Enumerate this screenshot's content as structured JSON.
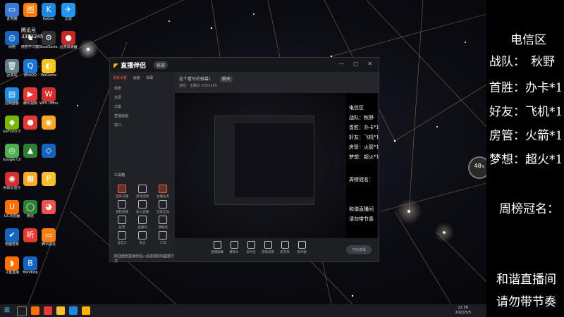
{
  "desktop": {
    "icons": [
      {
        "label": "此电脑",
        "color": "#3a7bd5",
        "glyph": "▭"
      },
      {
        "label": "",
        "color": "#ff7a00",
        "glyph": "图"
      },
      {
        "label": "KaGou",
        "color": "#1e88e5",
        "glyph": "K"
      },
      {
        "label": "迅雷",
        "color": "#2196f3",
        "glyph": "✈"
      },
      {
        "label": "网络",
        "color": "#1565c0",
        "glyph": "◎"
      },
      {
        "label": "随意学习模拟",
        "color": "#222",
        "glyph": "♞"
      },
      {
        "label": "SteelSeries",
        "color": "#333",
        "glyph": "⚙"
      },
      {
        "label": "迅游加速器",
        "color": "#c62828",
        "glyph": "●"
      },
      {
        "label": "回收站",
        "color": "#607d8b",
        "glyph": "🗑"
      },
      {
        "label": "腾讯QQ",
        "color": "#1976d2",
        "glyph": "Q"
      },
      {
        "label": "WeGame",
        "color": "#f5c518",
        "glyph": "◐"
      },
      {
        "label": "控制面板",
        "color": "#1e88e5",
        "glyph": "▤"
      },
      {
        "label": "腾讯视频",
        "color": "#e53935",
        "glyph": "▶"
      },
      {
        "label": "WPS Office",
        "color": "#d32f2f",
        "glyph": "W"
      },
      {
        "label": "GeForce Experience",
        "color": "#76b900",
        "glyph": "◆"
      },
      {
        "label": "",
        "color": "#e53935",
        "glyph": "●"
      },
      {
        "label": "",
        "color": "#f9a825",
        "glyph": "◉"
      },
      {
        "label": "Google Chrome",
        "color": "#4caf50",
        "glyph": "◎"
      },
      {
        "label": "",
        "color": "#2e7d32",
        "glyph": "▲"
      },
      {
        "label": "",
        "color": "#1565c0",
        "glyph": "◇"
      },
      {
        "label": "网易云音乐",
        "color": "#d32f2f",
        "glyph": "◉"
      },
      {
        "label": "",
        "color": "#f9a825",
        "glyph": "▦"
      },
      {
        "label": "UC浏览器",
        "color": "#ff6f00",
        "glyph": "U"
      },
      {
        "label": "微信",
        "color": "#2e7d32",
        "glyph": "◯"
      },
      {
        "label": "",
        "color": "#fbc02d",
        "glyph": "P"
      },
      {
        "label": "电脑管家",
        "color": "#1565c0",
        "glyph": "✔"
      },
      {
        "label": "",
        "color": "#e53935",
        "glyph": "听"
      },
      {
        "label": "",
        "color": "#ef5350",
        "glyph": "◕"
      },
      {
        "label": "斗鱼直播",
        "color": "#ff6f00",
        "glyph": "◗"
      },
      {
        "label": "Bandizip",
        "color": "#1565c0",
        "glyph": "B"
      },
      {
        "label": "腾讯会议",
        "color": "#f57f17",
        "glyph": "▭"
      }
    ],
    "top_text_1": "腾讯号",
    "top_text_2": "3353245"
  },
  "app": {
    "title": "直播伴侣",
    "badge": "帐密",
    "window_controls": "— ▢ ✕",
    "tabs": [
      "场景设置",
      "画面",
      "弹幕"
    ],
    "scenes": [
      "场景",
      "全屏",
      "文案",
      "直播画面",
      "窗口"
    ],
    "tools_title": "工具箱",
    "tools": [
      "连屏开播",
      "游戏宝物",
      "主播任务",
      "视频直播",
      "加入直播",
      "连麦互动",
      "投票",
      "直播间",
      "弹幕墙",
      "自定义",
      "发言",
      "工具"
    ],
    "tip": "欢迎使用直播伴侣，请选择你的直播方式",
    "room_title": "这个看写的弹幕！",
    "room_tag": "聊天",
    "subinfo": "游戏 · 主播ID 3353245",
    "bottom_buttons": [
      "直播屏幕",
      "摄像头",
      "多机位",
      "游戏场景",
      "麦克风",
      "扬声器"
    ],
    "go_live": "开始直播",
    "statusbar": "CPU: 11%  内存: 40%  FPS: 30  码率: 0kb/s"
  },
  "side": {
    "zone": "电信区",
    "rows": [
      {
        "label": "战队：",
        "value": "秋野"
      },
      {
        "label": "首胜：",
        "value": "办卡*1"
      },
      {
        "label": "好友：",
        "value": "飞机*1"
      },
      {
        "label": "房管：",
        "value": "火箭*1"
      },
      {
        "label": "梦想：",
        "value": "超火*1"
      }
    ],
    "weekly": "周榜冠名：",
    "footer_1": "和谐直播间",
    "footer_2": "请勿带节奏"
  },
  "speed_meter": {
    "value": "48",
    "unit": "%"
  },
  "taskbar": {
    "time": "22:56",
    "date": "2022/5/3"
  },
  "colors": {
    "accent": "#ff5a3c",
    "brand": "#ffb100"
  }
}
